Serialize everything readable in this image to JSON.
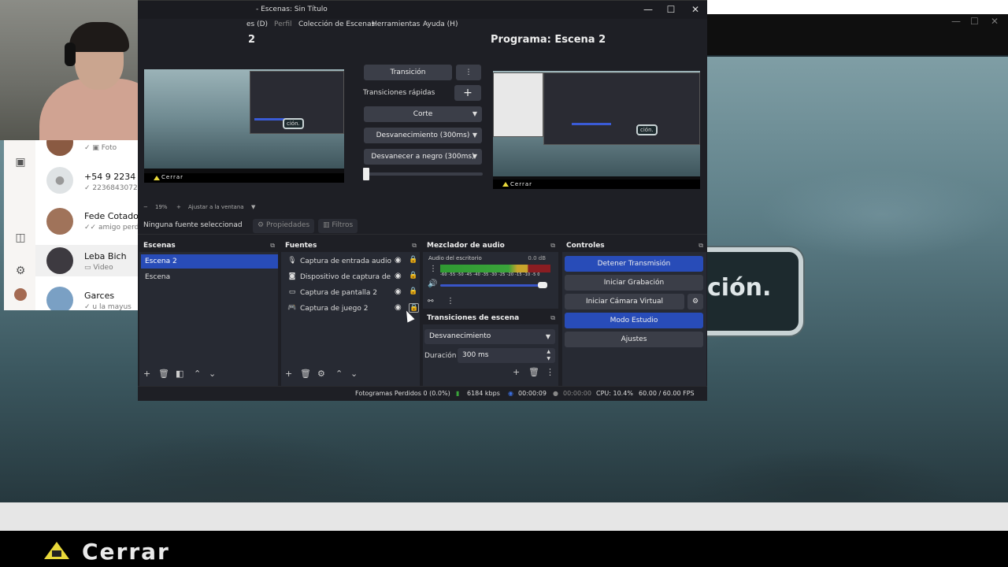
{
  "obs": {
    "title": "- Escenas: Sin Título",
    "menu": [
      "es (D)",
      "Perfil",
      "Colección de Escenas",
      "Herramientas",
      "Ayuda (H)"
    ],
    "preview_label": "2",
    "program_label": "Programa: Escena 2",
    "transition": {
      "button": "Transición",
      "quick_label": "Transiciones rápidas",
      "items": [
        "Corte",
        "Desvanecimiento (300ms)",
        "Desvanecer a negro (300ms)"
      ]
    },
    "zoom": {
      "value": "19%",
      "fit": "Ajustar a la ventana"
    },
    "source_bar": {
      "no_source": "Ninguna fuente seleccionad",
      "properties": "Propiedades",
      "filters": "Filtros"
    },
    "scenes": {
      "title": "Escenas",
      "items": [
        "Escena 2",
        "Escena"
      ]
    },
    "sources": {
      "title": "Fuentes",
      "items": [
        "Captura de entrada audio",
        "Dispositivo de captura de vid",
        "Captura de pantalla 2",
        "Captura de juego 2"
      ]
    },
    "mixer": {
      "title": "Mezclador de audio",
      "track": "Audio del escritorio",
      "db": "0.0 dB",
      "scale": "-60 -55 -50 -45 -40 -35 -30 -25 -20 -15 -10 -5 0"
    },
    "scene_transitions": {
      "title": "Transiciones de escena",
      "selected": "Desvanecimiento",
      "duration_label": "Duración",
      "duration": "300 ms"
    },
    "controls": {
      "title": "Controles",
      "stop_stream": "Detener Transmisión",
      "start_record": "Iniciar Grabación",
      "virtual_cam": "Iniciar Cámara Virtual",
      "studio_mode": "Modo Estudio",
      "settings": "Ajustes"
    },
    "status": {
      "dropped": "Fotogramas Perdidos 0 (0.0%)",
      "bitrate": "6184 kbps",
      "stream_time": "00:00:09",
      "rec_time": "00:00:00",
      "cpu": "CPU: 10.4%",
      "fps": "60.00 / 60.00 FPS"
    },
    "thumb_close": "Cerrar",
    "thumb_bubble": "ción."
  },
  "whatsapp": {
    "chats": [
      {
        "name": "",
        "sub": "Foto"
      },
      {
        "name": "+54 9 2234 ...",
        "sub": "2236843072"
      },
      {
        "name": "Fede Cotado",
        "sub": "amigo perdo"
      },
      {
        "name": "Leba Bich",
        "sub": "Video"
      },
      {
        "name": "Garces",
        "sub": "u la mayus"
      }
    ]
  },
  "game": {
    "bubble_text": "ción.",
    "close_text": "Cerrar"
  },
  "colors": {
    "accent": "#284cb8",
    "obs_bg": "#1e1f25",
    "dock_bg": "#272a33"
  }
}
